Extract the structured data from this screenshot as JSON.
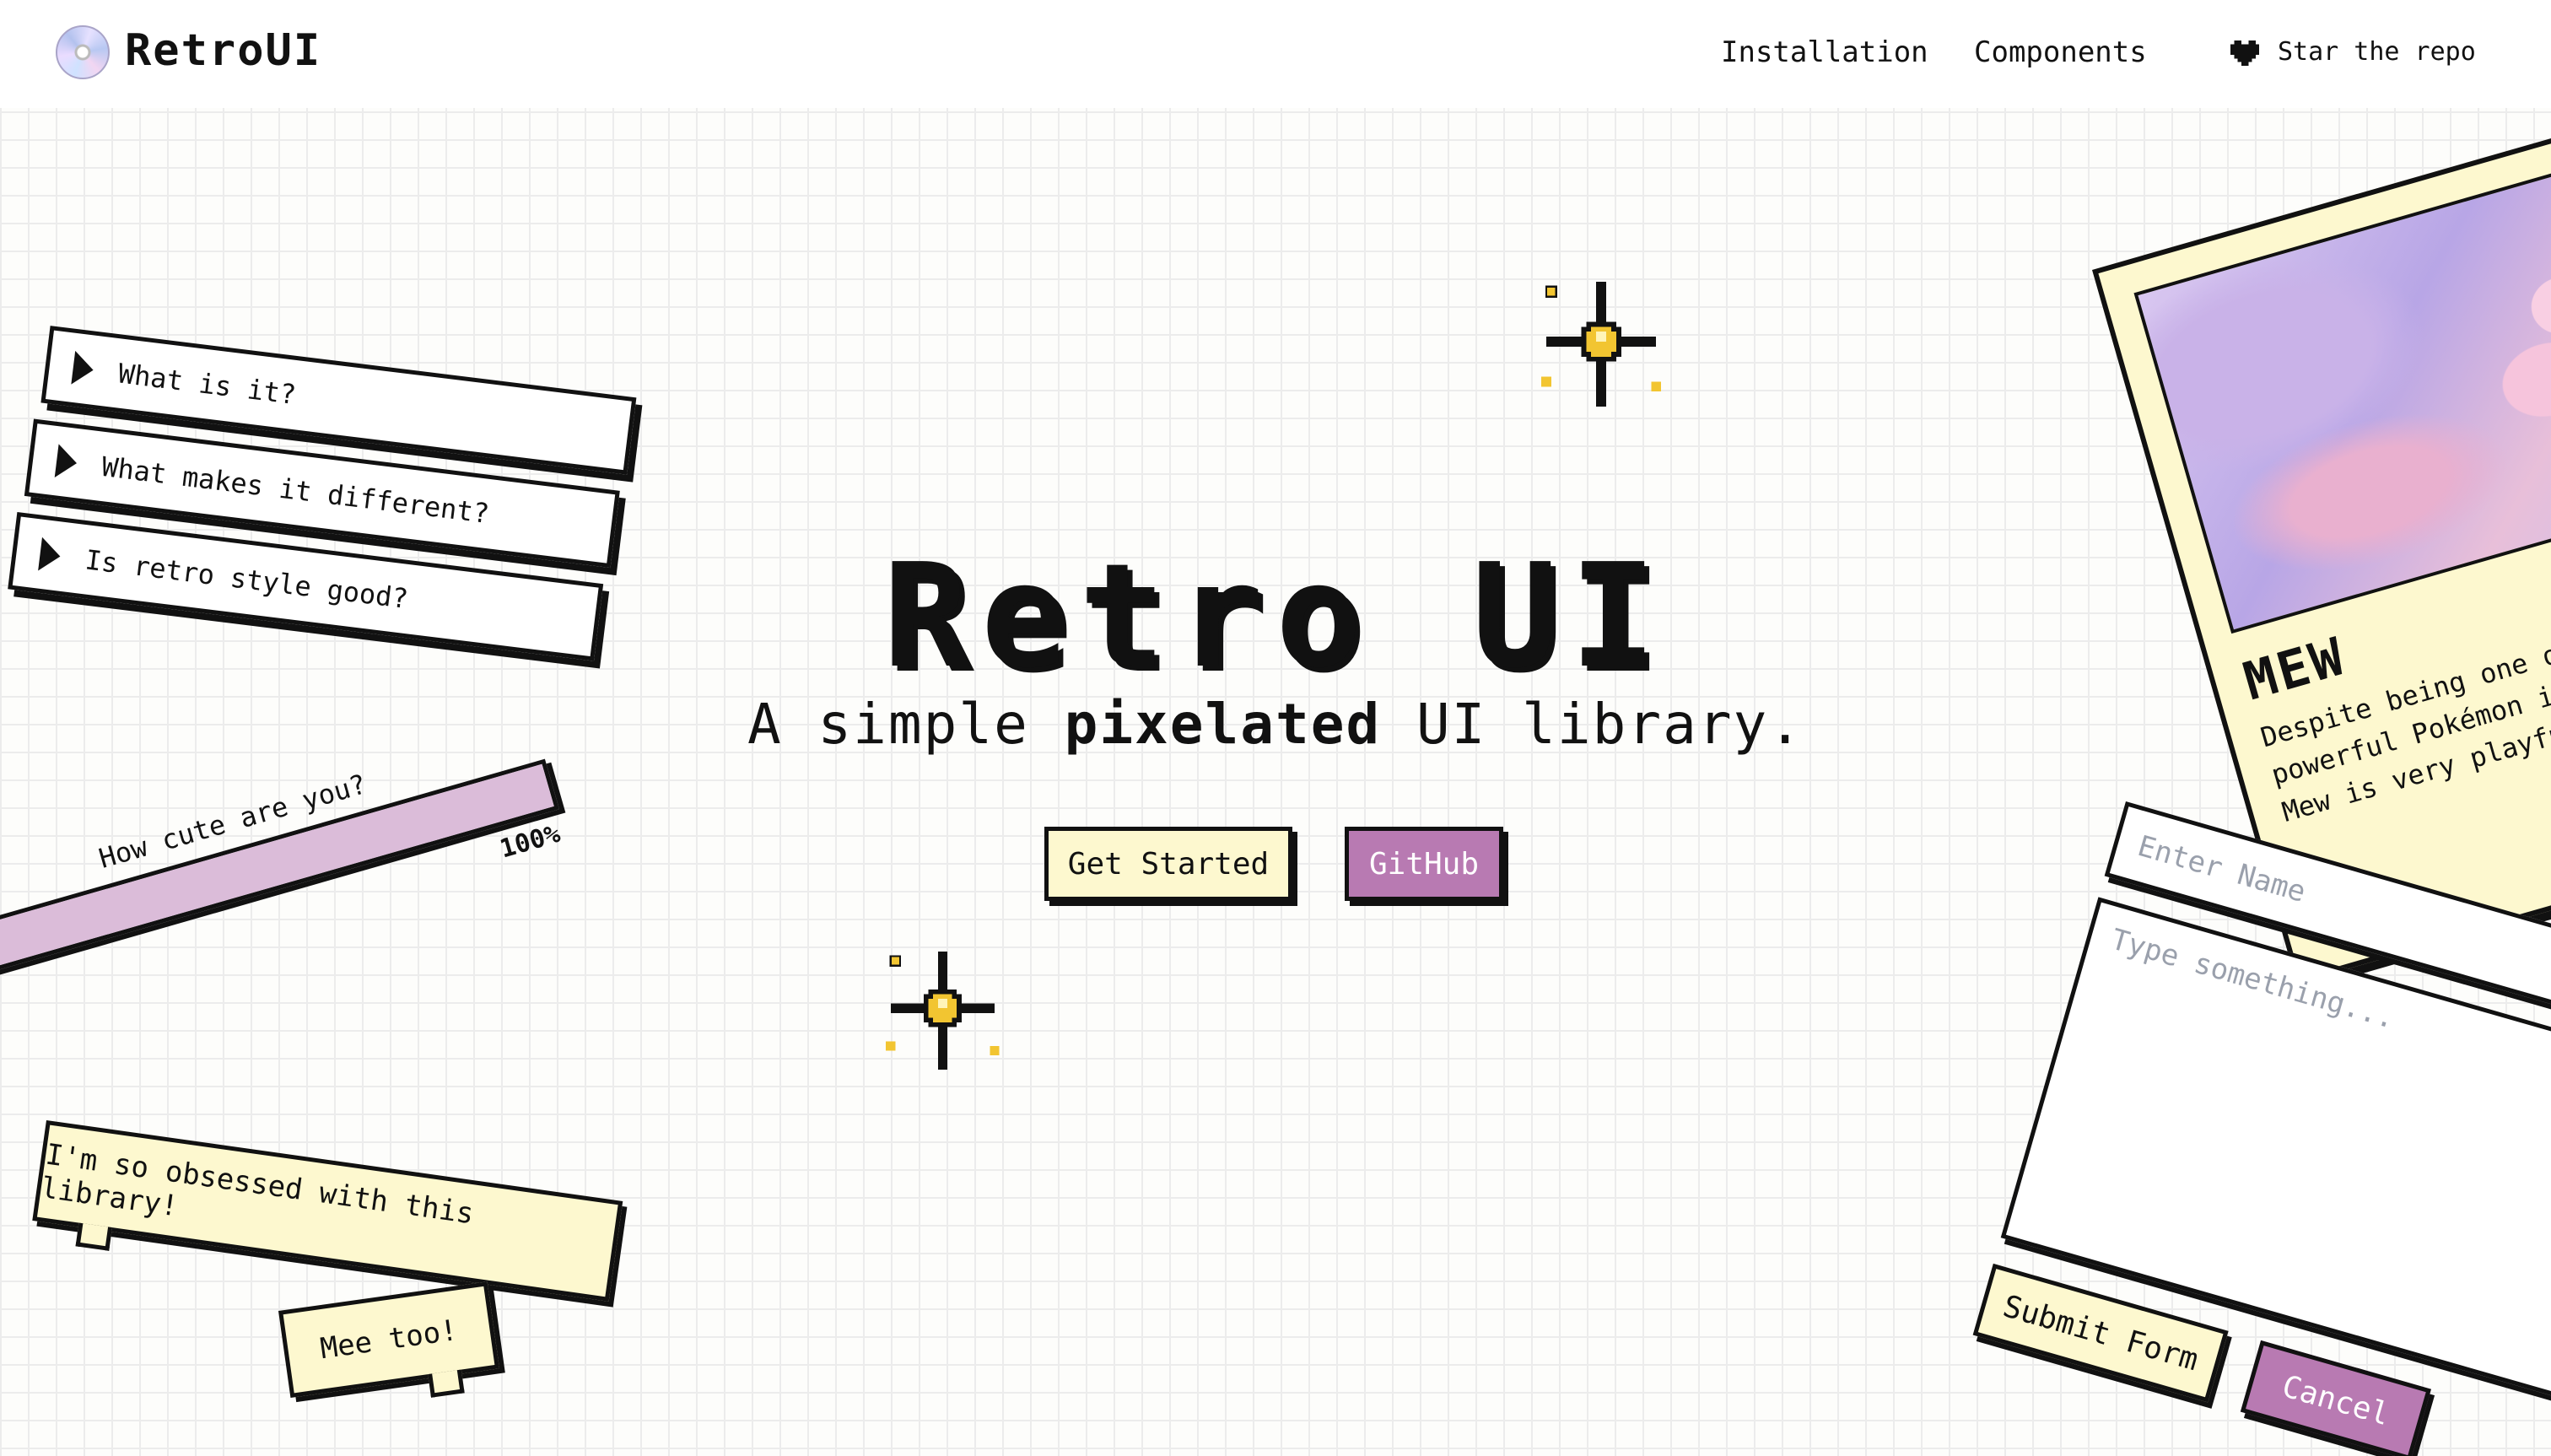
{
  "header": {
    "brand": "RetroUI",
    "nav": {
      "installation": "Installation",
      "components": "Components",
      "star": "Star the repo"
    }
  },
  "hero": {
    "title": "Retro UI",
    "subtitle_pre": "A simple ",
    "subtitle_bold": "pixelated",
    "subtitle_post": " UI library.",
    "get_started": "Get Started",
    "github": "GitHub"
  },
  "accordion": {
    "items": [
      {
        "label": "What is it?"
      },
      {
        "label": "What makes it different?"
      },
      {
        "label": "Is retro style good?"
      }
    ]
  },
  "progress": {
    "label": "How cute are you?",
    "value": 100,
    "value_text": "100%"
  },
  "bubbles": {
    "first": "I'm so obsessed with this library!",
    "second": "Mee too!"
  },
  "card": {
    "title": "MEW",
    "description": "Despite being one of the most powerful Pokémon in the world, Mew is very playful..."
  },
  "form": {
    "name_placeholder": "Enter Name",
    "message_placeholder": "Type something...",
    "submit": "Submit Form",
    "cancel": "Cancel"
  },
  "colors": {
    "accent_pink": "#b87ab2",
    "accent_cream": "#fdf8cf",
    "progress_fill": "#dbbcd9",
    "sparkle_gold": "#f2c531"
  },
  "icons": {
    "logo": "cd-disc-icon",
    "star_repo": "heart-icon",
    "accordion": "play-triangle-icon",
    "decoration": "sparkle-icon"
  }
}
